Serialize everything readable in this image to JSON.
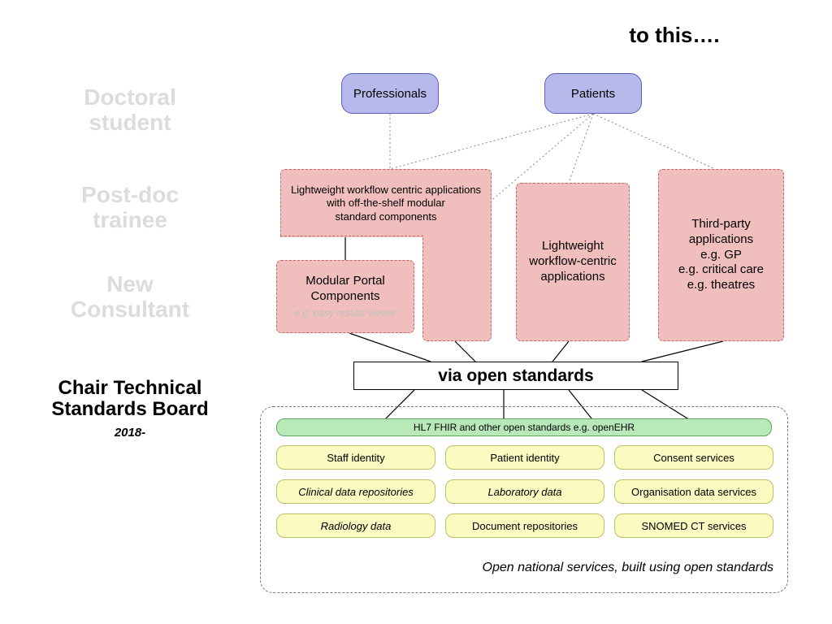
{
  "heading": "to this….",
  "left": {
    "doctoral": "Doctoral\nstudent",
    "postdoc": "Post-doc\ntrainee",
    "newcons": "New\nConsultant",
    "chair": "Chair Technical\nStandards Board",
    "chair_sub": "2018-"
  },
  "top": {
    "professionals": "Professionals",
    "patients": "Patients"
  },
  "apps": {
    "lw_modular": "Lightweight workflow centric applications\nwith off-the-shelf modular\nstandard components",
    "modular_portal": "Modular Portal\nComponents",
    "modular_portal_sub": "e.g. easy results viewer",
    "lw_centric": "Lightweight\nworkflow-centric\napplications",
    "third_party": "Third-party\napplications\ne.g. GP\ne.g. critical care\ne.g. theatres"
  },
  "open_standards_bar": "via open standards",
  "services": {
    "caption": "Open national services, built using open standards",
    "green": "HL7 FHIR and other open standards e.g. openEHR",
    "row1": [
      "Staff identity",
      "Patient identity",
      "Consent services"
    ],
    "row2": [
      "Clinical data repositories",
      "Laboratory data",
      "Organisation data services"
    ],
    "row3": [
      "Radiology data",
      "Document repositories",
      "SNOMED CT services"
    ],
    "row2_italic": [
      true,
      true,
      false
    ],
    "row3_italic": [
      true,
      false,
      false
    ]
  }
}
